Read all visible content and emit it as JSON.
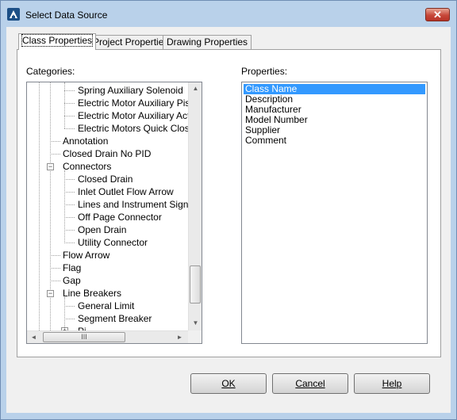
{
  "window": {
    "title": "Select Data Source",
    "close_glyph": "✕"
  },
  "tabs": [
    {
      "label": "Class Properties"
    },
    {
      "label": "Project Properties"
    },
    {
      "label": "Drawing Properties"
    }
  ],
  "categories": {
    "label": "Categories:",
    "items": [
      {
        "label": "Spring Auxiliary Solenoid"
      },
      {
        "label": "Electric Motor Auxiliary Piston"
      },
      {
        "label": "Electric Motor Auxiliary Actuat"
      },
      {
        "label": "Electric Motors Quick Closing"
      },
      {
        "label": "Annotation"
      },
      {
        "label": "Closed Drain No PID"
      },
      {
        "label": "Connectors"
      },
      {
        "label": "Closed Drain"
      },
      {
        "label": "Inlet Outlet Flow Arrow"
      },
      {
        "label": "Lines and Instrument Signal C"
      },
      {
        "label": "Off Page Connector"
      },
      {
        "label": "Open Drain"
      },
      {
        "label": "Utility Connector"
      },
      {
        "label": "Flow Arrow"
      },
      {
        "label": "Flag"
      },
      {
        "label": "Gap"
      },
      {
        "label": "Line Breakers"
      },
      {
        "label": "General Limit"
      },
      {
        "label": "Segment Breaker"
      },
      {
        "label": "Pi"
      }
    ],
    "scroll_up": "▲",
    "scroll_down": "▼",
    "scroll_left": "◄",
    "scroll_right": "►",
    "thumb_grip": "III"
  },
  "properties": {
    "label": "Properties:",
    "items": [
      "Class Name",
      "Description",
      "Manufacturer",
      "Model Number",
      "Supplier",
      "Comment"
    ],
    "selected": "Class Name"
  },
  "buttons": {
    "ok": "OK",
    "cancel": "Cancel",
    "help": "Help"
  }
}
